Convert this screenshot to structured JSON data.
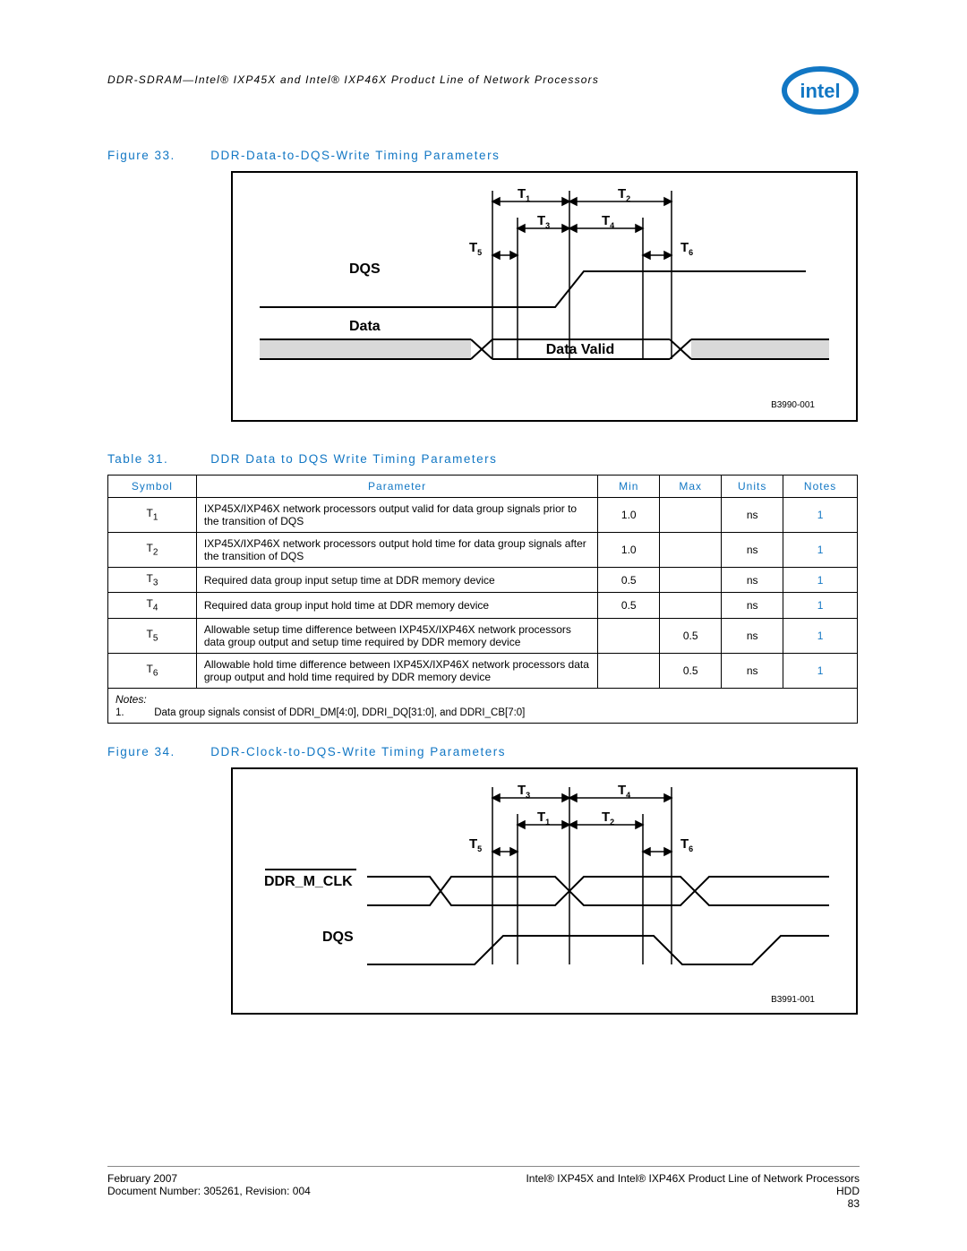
{
  "header": {
    "doc_line": "DDR-SDRAM—Intel® IXP45X and Intel® IXP46X Product Line of Network Processors"
  },
  "figure33": {
    "num": "Figure 33.",
    "title": "DDR-Data-to-DQS-Write Timing Parameters",
    "sig1": "DQS",
    "sig2": "Data",
    "valid": "Data Valid",
    "ref": "B3990-001",
    "t1": "T",
    "t1s": "1",
    "t2": "T",
    "t2s": "2",
    "t3": "T",
    "t3s": "3",
    "t4": "T",
    "t4s": "4",
    "t5": "T",
    "t5s": "5",
    "t6": "T",
    "t6s": "6"
  },
  "table31": {
    "num": "Table 31.",
    "title": "DDR Data to DQS Write Timing Parameters",
    "headers": {
      "symbol": "Symbol",
      "parameter": "Parameter",
      "min": "Min",
      "max": "Max",
      "units": "Units",
      "notes": "Notes"
    },
    "rows": [
      {
        "sym": "T",
        "sub": "1",
        "param": "IXP45X/IXP46X network processors output valid for data group signals prior to the transition of DQS",
        "min": "1.0",
        "max": "",
        "units": "ns",
        "notes": "1"
      },
      {
        "sym": "T",
        "sub": "2",
        "param": "IXP45X/IXP46X network processors output hold time for data group signals after the transition of DQS",
        "min": "1.0",
        "max": "",
        "units": "ns",
        "notes": "1"
      },
      {
        "sym": "T",
        "sub": "3",
        "param": "Required data group input setup time at DDR memory device",
        "min": "0.5",
        "max": "",
        "units": "ns",
        "notes": "1"
      },
      {
        "sym": "T",
        "sub": "4",
        "param": "Required data group input hold time at DDR memory device",
        "min": "0.5",
        "max": "",
        "units": "ns",
        "notes": "1"
      },
      {
        "sym": "T",
        "sub": "5",
        "param": "Allowable setup time difference between IXP45X/IXP46X network processors data group output and setup time required by DDR memory device",
        "min": "",
        "max": "0.5",
        "units": "ns",
        "notes": "1"
      },
      {
        "sym": "T",
        "sub": "6",
        "param": "Allowable hold time difference between IXP45X/IXP46X network processors data group output and hold time required by DDR memory device",
        "min": "",
        "max": "0.5",
        "units": "ns",
        "notes": "1"
      }
    ],
    "notes_label": "Notes:",
    "notes_num": "1.",
    "notes_text": "Data group signals consist of DDRI_DM[4:0], DDRI_DQ[31:0], and DDRI_CB[7:0]"
  },
  "figure34": {
    "num": "Figure 34.",
    "title": "DDR-Clock-to-DQS-Write Timing Parameters",
    "sig1": "DDR_M_CLK",
    "sig2": "DQS",
    "ref": "B3991-001",
    "t1": "T",
    "t1s": "1",
    "t2": "T",
    "t2s": "2",
    "t3": "T",
    "t3s": "3",
    "t4": "T",
    "t4s": "4",
    "t5": "T",
    "t5s": "5",
    "t6": "T",
    "t6s": "6"
  },
  "footer": {
    "left1": "February 2007",
    "left2": "Document Number: 305261, Revision: 004",
    "right1": "Intel® IXP45X and Intel® IXP46X Product Line of Network Processors",
    "right2": "HDD",
    "right3": "83"
  }
}
